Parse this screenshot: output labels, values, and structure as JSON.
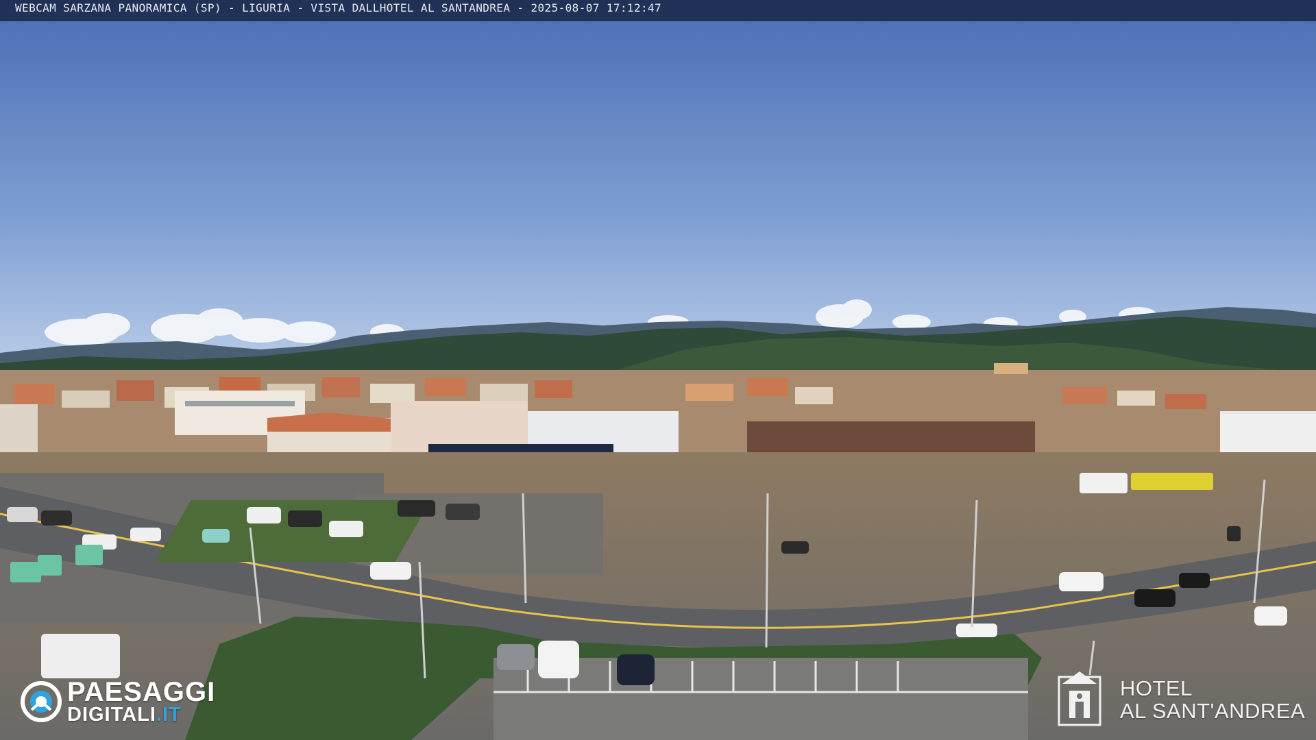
{
  "overlay": {
    "caption": "WEBCAM SARZANA PANORAMICA (SP) - LIGURIA - VISTA DALLHOTEL AL SANTANDREA - 2025-08-07  17:12:47"
  },
  "branding_left": {
    "line1": "PAESAGGI",
    "line2_main": "DIGITALI",
    "line2_ext": ".IT",
    "accent_color": "#2fa3e0"
  },
  "branding_right": {
    "line1": "HOTEL",
    "line2": "AL SANT'ANDREA"
  },
  "colors": {
    "sky_top": "#4a6fb5",
    "sky_bottom": "#a9c1e2",
    "hills": "#2f4a3a",
    "road": "#5d5f63"
  }
}
